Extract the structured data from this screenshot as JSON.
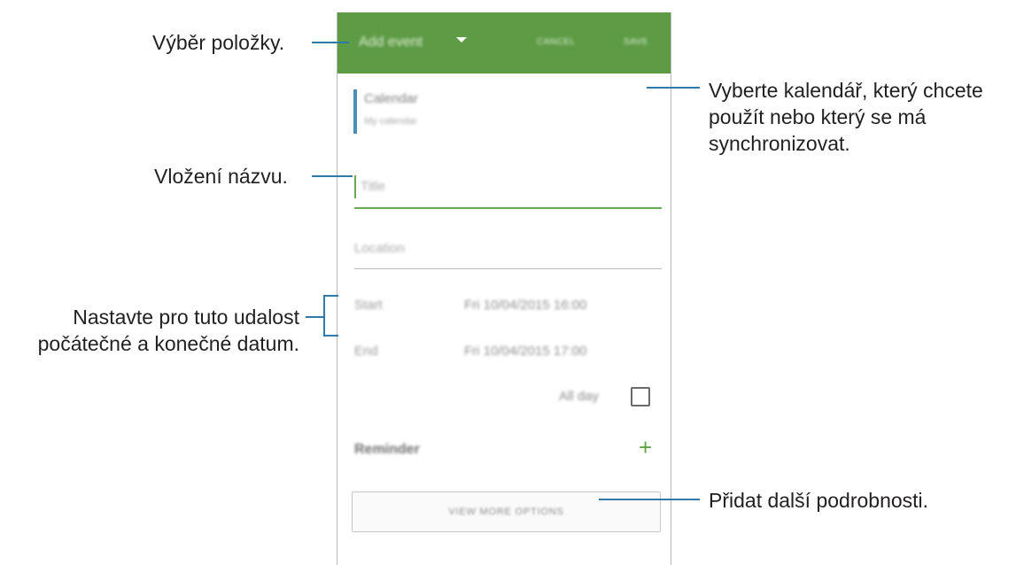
{
  "app_bar": {
    "title": "Add event",
    "cancel_label": "CANCEL",
    "save_label": "SAVE",
    "color": "#5d9b45"
  },
  "form": {
    "calendar_label": "Calendar",
    "calendar_value": "My calendar",
    "title_placeholder": "Title",
    "location_placeholder": "Location",
    "start_label": "Start",
    "start_value": "Fri 10/04/2015  16:00",
    "end_label": "End",
    "end_value": "Fri 10/04/2015  17:00",
    "allday_label": "All day",
    "allday_checked": false,
    "reminder_label": "Reminder",
    "reminder_add": "+",
    "more_options_label": "VIEW MORE OPTIONS"
  },
  "callouts": {
    "select_item": "Výběr položky.",
    "select_calendar": [
      "Vyberte kalendář, který chcete",
      "použít nebo který se má",
      "synchronizovat."
    ],
    "enter_title": "Vložení názvu.",
    "set_dates": [
      "Nastavte pro tuto udalost",
      "počátečné a konečné datum."
    ],
    "add_details": "Přidat další podrobnosti."
  },
  "colors": {
    "callout_line": "#2f7aa8",
    "accent_green": "#6aaa52"
  }
}
